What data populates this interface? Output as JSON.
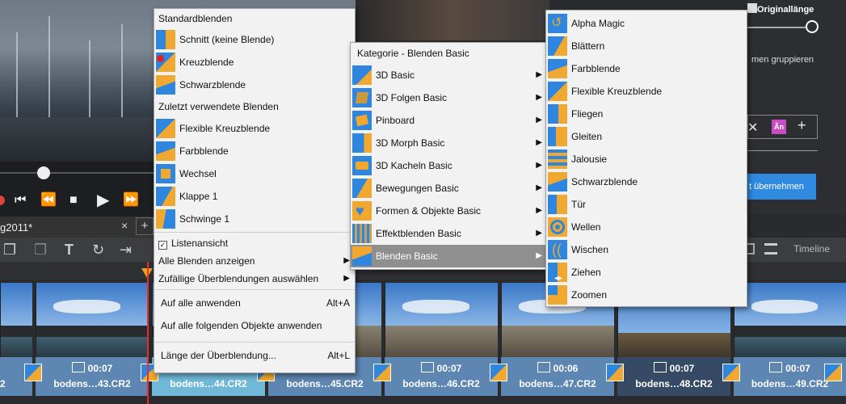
{
  "app": {
    "right_panel": {
      "section_label": "Originallänge",
      "group_text": "men gruppieren",
      "apply_button": "t übernehmen",
      "tile_label": "Ãn"
    },
    "tab": {
      "title": "g2011*",
      "close": "×",
      "add": "+"
    },
    "toolbar": {
      "view_label": "Timeline"
    },
    "clips": [
      {
        "duration": "",
        "name": "2",
        "style": "normal"
      },
      {
        "duration": "00:07",
        "name": "bodens…43.CR2",
        "style": "normal"
      },
      {
        "duration": "",
        "name": "bodens…44.CR2",
        "style": "selected"
      },
      {
        "duration": "",
        "name": "bodens…45.CR2",
        "style": "normal"
      },
      {
        "duration": "00:07",
        "name": "bodens…46.CR2",
        "style": "normal"
      },
      {
        "duration": "00:06",
        "name": "bodens…47.CR2",
        "style": "normal"
      },
      {
        "duration": "00:07",
        "name": "bodens…48.CR2",
        "style": "dark"
      },
      {
        "duration": "00:07",
        "name": "bodens…49.CR2",
        "style": "normal"
      }
    ]
  },
  "menu_main": {
    "header_standard": "Standardblenden",
    "standard_items": [
      "Schnitt (keine Blende)",
      "Kreuzblende",
      "Schwarzblende"
    ],
    "header_recent": "Zuletzt verwendete Blenden",
    "recent_items": [
      "Flexible Kreuzblende",
      "Farbblende",
      "Wechsel",
      "Klappe 1",
      "Schwinge 1"
    ],
    "list_view": "Listenansicht",
    "show_all": "Alle Blenden anzeigen",
    "random": "Zufällige Überblendungen auswählen",
    "apply_all": "Auf alle anwenden",
    "apply_all_shortcut": "Alt+A",
    "apply_following": "Auf alle folgenden Objekte anwenden",
    "duration": "Länge der Überblendung...",
    "duration_shortcut": "Alt+L"
  },
  "menu_category": {
    "header": "Kategorie - Blenden Basic",
    "items": [
      "3D Basic",
      "3D Folgen Basic",
      "Pinboard",
      "3D Morph Basic",
      "3D Kacheln Basic",
      "Bewegungen Basic",
      "Formen & Objekte Basic",
      "Effektblenden Basic",
      "Blenden Basic"
    ],
    "highlighted": "Blenden Basic"
  },
  "menu_blenden": {
    "items": [
      "Alpha Magic",
      "Blättern",
      "Farbblende",
      "Flexible Kreuzblende",
      "Fliegen",
      "Gleiten",
      "Jalousie",
      "Schwarzblende",
      "Tür",
      "Wellen",
      "Wischen",
      "Ziehen",
      "Zoomen"
    ]
  },
  "colors": {
    "icon_blue": "#2e86de",
    "icon_orange": "#f0a830",
    "highlight": "#8f8f8f"
  }
}
